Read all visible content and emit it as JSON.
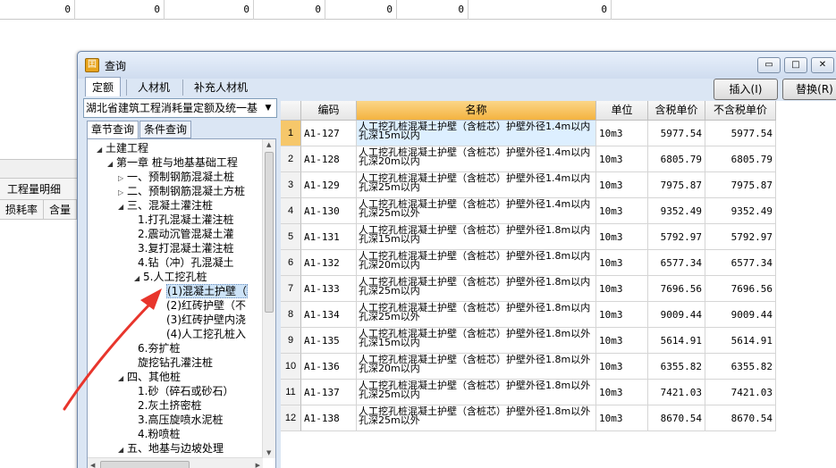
{
  "background": {
    "top_row_values": [
      "0",
      "0",
      "0",
      "0",
      "0",
      "0",
      "0"
    ],
    "panel_label": "工程量明细",
    "column_headers": [
      "损耗率",
      "含量"
    ]
  },
  "dialog": {
    "title": "查询",
    "window_controls": {
      "minimize": "▭",
      "maximize": "□",
      "close": "✕"
    },
    "top_tabs": [
      "定额",
      "人材机",
      "补充人材机"
    ],
    "active_top_tab": "定额",
    "insert_button": "插入(I)",
    "replace_button": "替换(R)"
  },
  "left_panel": {
    "library_select": "湖北省建筑工程消耗量定额及统一基",
    "query_tabs": [
      "章节查询",
      "条件查询"
    ],
    "active_query_tab": "章节查询",
    "tree": [
      {
        "label": "土建工程",
        "depth": 0,
        "expanded": true
      },
      {
        "label": "第一章  桩与地基基础工程",
        "depth": 1,
        "expanded": true
      },
      {
        "label": "一、预制钢筋混凝土桩",
        "depth": 2,
        "expanded": false
      },
      {
        "label": "二、预制钢筋混凝土方桩",
        "depth": 2,
        "expanded": false
      },
      {
        "label": "三、混凝土灌注桩",
        "depth": 2,
        "expanded": true
      },
      {
        "label": "1.打孔混凝土灌注桩",
        "depth": 3
      },
      {
        "label": "2.震动沉管混凝土灌",
        "depth": 3
      },
      {
        "label": "3.复打混凝土灌注桩",
        "depth": 3
      },
      {
        "label": "4.钻（冲）孔混凝土",
        "depth": 3
      },
      {
        "label": "5.人工挖孔桩",
        "depth": 3,
        "expanded": true
      },
      {
        "label": "(1)混凝土护壁（",
        "depth": 4,
        "selected": true
      },
      {
        "label": "(2)红砖护壁（不",
        "depth": 4
      },
      {
        "label": "(3)红砖护壁内浇",
        "depth": 4
      },
      {
        "label": "(4)人工挖孔桩入",
        "depth": 4
      },
      {
        "label": "6.夯扩桩",
        "depth": 3
      },
      {
        "label": "旋挖钻孔灌注桩",
        "depth": 3
      },
      {
        "label": "四、其他桩",
        "depth": 2,
        "expanded": true
      },
      {
        "label": "1.砂（碎石或砂石）",
        "depth": 3
      },
      {
        "label": "2.灰土挤密桩",
        "depth": 3
      },
      {
        "label": "3.高压旋喷水泥桩",
        "depth": 3
      },
      {
        "label": "4.粉喷桩",
        "depth": 3
      },
      {
        "label": "五、地基与边坡处理",
        "depth": 2,
        "expanded": true
      }
    ]
  },
  "table": {
    "columns": [
      "",
      "编码",
      "名称",
      "单位",
      "含税单价",
      "不含税单价"
    ],
    "selected_row": 0,
    "rows": [
      {
        "num": "1",
        "code": "A1-127",
        "name": "人工挖孔桩混凝土护壁（含桩芯）护壁外径1.4m以内 孔深15m以内",
        "unit": "10m3",
        "tax_price": "5977.54",
        "notax_price": "5977.54"
      },
      {
        "num": "2",
        "code": "A1-128",
        "name": "人工挖孔桩混凝土护壁（含桩芯）护壁外径1.4m以内 孔深20m以内",
        "unit": "10m3",
        "tax_price": "6805.79",
        "notax_price": "6805.79"
      },
      {
        "num": "3",
        "code": "A1-129",
        "name": "人工挖孔桩混凝土护壁（含桩芯）护壁外径1.4m以内 孔深25m以内",
        "unit": "10m3",
        "tax_price": "7975.87",
        "notax_price": "7975.87"
      },
      {
        "num": "4",
        "code": "A1-130",
        "name": "人工挖孔桩混凝土护壁（含桩芯）护壁外径1.4m以内 孔深25m以外",
        "unit": "10m3",
        "tax_price": "9352.49",
        "notax_price": "9352.49"
      },
      {
        "num": "5",
        "code": "A1-131",
        "name": "人工挖孔桩混凝土护壁（含桩芯）护壁外径1.8m以内 孔深15m以内",
        "unit": "10m3",
        "tax_price": "5792.97",
        "notax_price": "5792.97"
      },
      {
        "num": "6",
        "code": "A1-132",
        "name": "人工挖孔桩混凝土护壁（含桩芯）护壁外径1.8m以内 孔深20m以内",
        "unit": "10m3",
        "tax_price": "6577.34",
        "notax_price": "6577.34"
      },
      {
        "num": "7",
        "code": "A1-133",
        "name": "人工挖孔桩混凝土护壁（含桩芯）护壁外径1.8m以内 孔深25m以内",
        "unit": "10m3",
        "tax_price": "7696.56",
        "notax_price": "7696.56"
      },
      {
        "num": "8",
        "code": "A1-134",
        "name": "人工挖孔桩混凝土护壁（含桩芯）护壁外径1.8m以内 孔深25m以外",
        "unit": "10m3",
        "tax_price": "9009.44",
        "notax_price": "9009.44"
      },
      {
        "num": "9",
        "code": "A1-135",
        "name": "人工挖孔桩混凝土护壁（含桩芯）护壁外径1.8m以外 孔深15m以内",
        "unit": "10m3",
        "tax_price": "5614.91",
        "notax_price": "5614.91"
      },
      {
        "num": "10",
        "code": "A1-136",
        "name": "人工挖孔桩混凝土护壁（含桩芯）护壁外径1.8m以外 孔深20m以内",
        "unit": "10m3",
        "tax_price": "6355.82",
        "notax_price": "6355.82"
      },
      {
        "num": "11",
        "code": "A1-137",
        "name": "人工挖孔桩混凝土护壁（含桩芯）护壁外径1.8m以外 孔深25m以内",
        "unit": "10m3",
        "tax_price": "7421.03",
        "notax_price": "7421.03"
      },
      {
        "num": "12",
        "code": "A1-138",
        "name": "人工挖孔桩混凝土护壁（含桩芯）护壁外径1.8m以外 孔深25m以外",
        "unit": "10m3",
        "tax_price": "8670.54",
        "notax_price": "8670.54"
      }
    ]
  },
  "annotation_color": "#e8352c"
}
